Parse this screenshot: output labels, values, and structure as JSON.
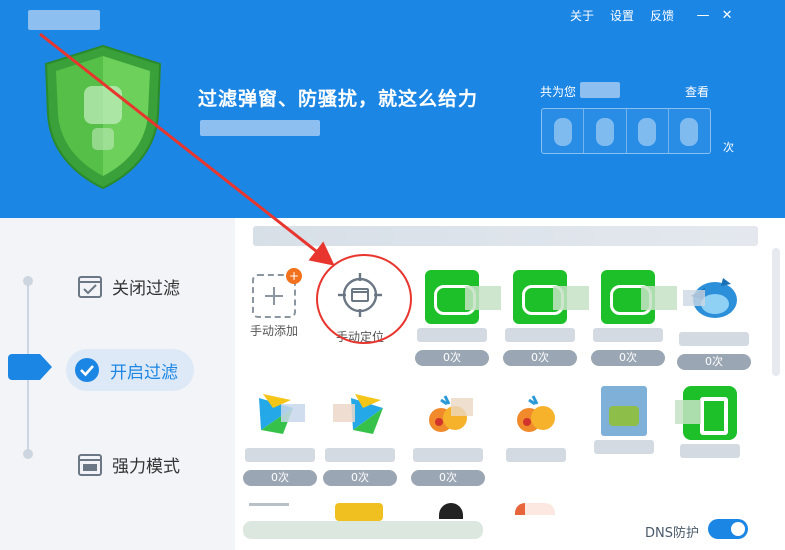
{
  "window": {
    "links": [
      "关于",
      "设置",
      "反馈"
    ],
    "minimize_glyph": "—",
    "close_glyph": "✕"
  },
  "hero": {
    "slogan": "过滤弹窗、防骚扰，就这么给力",
    "count_label": "共为您",
    "view_link": "查看",
    "count_unit": "次"
  },
  "modes": {
    "items": [
      {
        "label": "关闭过滤",
        "icon": "checkbox-icon",
        "active": false
      },
      {
        "label": "开启过滤",
        "icon": "check-circle-icon",
        "active": true
      },
      {
        "label": "强力模式",
        "icon": "window-icon",
        "active": false
      }
    ]
  },
  "tiles": {
    "add_label": "手动添加",
    "locate_label": "手动定位",
    "row1_badges": [
      "0次",
      "0次",
      "0次",
      "0次"
    ],
    "row2_badges": [
      "0次",
      "0次",
      "0次"
    ]
  },
  "footer": {
    "dns_label": "DNS防护",
    "dns_enabled": true
  },
  "colors": {
    "brand_blue": "#1c86e4",
    "shield_green": "#5cc14c",
    "badge_gray": "#9aa6b3",
    "annotation_red": "#e8362e"
  }
}
